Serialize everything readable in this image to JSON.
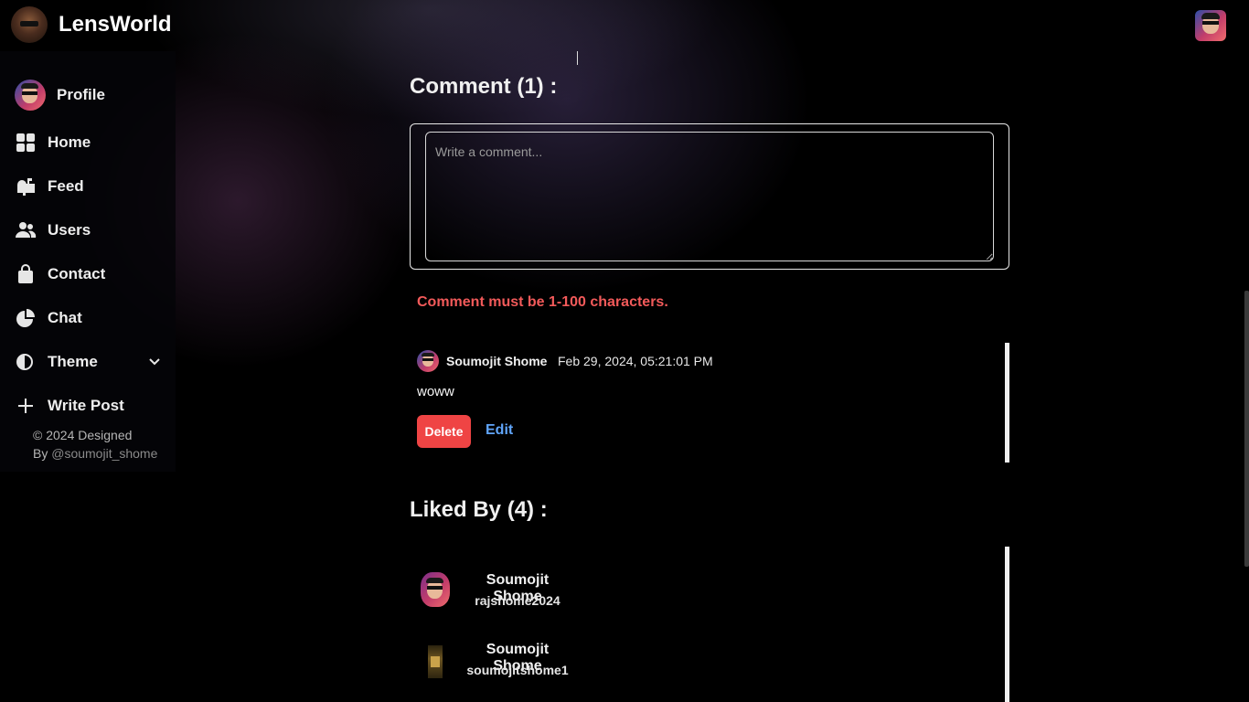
{
  "app": {
    "title": "LensWorld"
  },
  "sidebar": {
    "items": [
      {
        "label": "Profile",
        "icon": "avatar"
      },
      {
        "label": "Home",
        "icon": "grid-icon"
      },
      {
        "label": "Feed",
        "icon": "mailbox-icon"
      },
      {
        "label": "Users",
        "icon": "users-icon"
      },
      {
        "label": "Contact",
        "icon": "bag-icon"
      },
      {
        "label": "Chat",
        "icon": "pie-icon"
      },
      {
        "label": "Theme",
        "icon": "contrast-icon"
      },
      {
        "label": "Write Post",
        "icon": "plus-icon"
      }
    ],
    "copyright_line1": "© 2024 Designed",
    "copyright_by": "By ",
    "copyright_handle": "@soumojit_shome"
  },
  "comments": {
    "title": "Comment (1) :",
    "placeholder": "Write a comment...",
    "error": "Comment must be 1-100 characters.",
    "items": [
      {
        "author": "Soumojit Shome",
        "date": "Feb 29, 2024, 05:21:01 PM",
        "text": "woww",
        "delete_label": "Delete",
        "edit_label": "Edit"
      }
    ]
  },
  "liked_by": {
    "title": "Liked By (4) :",
    "users": [
      {
        "name": "Soumojit Shome",
        "username": "rajshome2024"
      },
      {
        "name": "Soumojit Shome",
        "username": "soumojitshome1"
      }
    ]
  },
  "colors": {
    "error": "#f25a5a",
    "delete": "#ef4444",
    "edit_link": "#60a5fa"
  }
}
